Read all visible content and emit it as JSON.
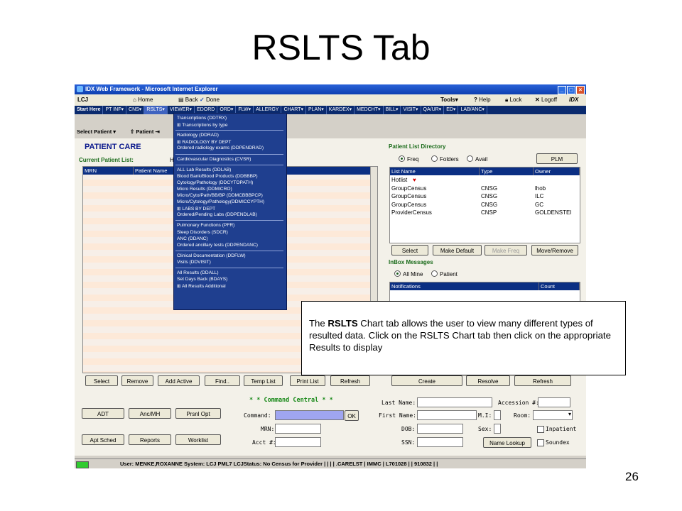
{
  "slide": {
    "title": "RSLTS Tab",
    "page_number": "26"
  },
  "window": {
    "title": "IDX Web Framework - Microsoft Internet Explorer",
    "user_code": "LCJ",
    "toolbar": {
      "home": "Home",
      "back": "Back",
      "done": "Done",
      "tools": "Tools",
      "help": "Help",
      "lock": "Lock",
      "logoff": "Logoff",
      "brand": "IDX"
    },
    "nav": [
      "Start Here",
      "PT INF▾",
      "CNS▾",
      "RSLTS▾",
      "VIEWER▾",
      "EDORD",
      "ORD▾",
      "FLW▾",
      "ALLERGY",
      "CHART▾",
      "PLAN▾",
      "KARDEX▾",
      "MEDCHT▾",
      "BILL▾",
      "VISIT▾",
      "QA/UR▾",
      "ED▾",
      "LAB/ANC▾"
    ],
    "subbar": {
      "select_patient": "Select Patient",
      "patient": "Patient"
    }
  },
  "dropdown": {
    "items": [
      "Transcriptions (DDTRX)",
      "⊞ Transcriptions by type",
      "-",
      "Radiology (DDRAD)",
      "⊞ RADIOLOGY BY DEPT",
      "Ordered radiology exams (DDPENDRAD)",
      "-",
      "Cardiovascular Diagnostics (CVSR)",
      "-",
      "ALL Lab Results (DDLAB)",
      "Blood Bank/Blood Products (DDBBBP)",
      "Cytology/Pathology (DDCYTOPATH)",
      "Micro Results (DDMICRO)",
      "Micro/Cyto/Path/BB/BP (DDMCBBBPCP)",
      "Micro/Cytology/Pathology(DDMICCYPTH)",
      "⊞ LABS BY DEPT",
      "Ordered/Pending Labs (DDPENDLAB)",
      "-",
      "Pulmonary Functions (PFR)",
      "Sleep Disorders (SDCR)",
      "ANC (DDANC)",
      "Ordered ancillary tests (DDPENDANC)",
      "-",
      "Clinical Documentation (DDFLW)",
      "Visits (DDVISIT)",
      "-",
      "All Results (DDALL)",
      "Set Days Back (BDAYS)",
      "⊞ All Results Additional"
    ]
  },
  "patient_care": {
    "heading": "PATIENT CARE",
    "current_list_label": "Current Patient List:",
    "current_list_value": "H",
    "columns": [
      "MRN",
      "Patient Name"
    ],
    "buttons": [
      "Select",
      "Remove",
      "Add Active",
      "Find..",
      "Temp List",
      "Print List",
      "Refresh",
      "Create",
      "Resolve",
      "Refresh"
    ]
  },
  "directory": {
    "heading": "Patient List Directory",
    "radios": [
      "Freq",
      "Folders",
      "Avail"
    ],
    "plm": "PLM",
    "columns": [
      "List Name",
      "Type",
      "Owner"
    ],
    "rows": [
      {
        "name": "Hotlist",
        "type": "",
        "owner": ""
      },
      {
        "name": "GroupCensus",
        "type": "CNSG",
        "owner": "lhob"
      },
      {
        "name": "GroupCensus",
        "type": "CNSG",
        "owner": "ILC"
      },
      {
        "name": "GroupCensus",
        "type": "CNSG",
        "owner": "GC"
      },
      {
        "name": "ProviderCensus",
        "type": "CNSP",
        "owner": "GOLDENSTEI"
      }
    ],
    "buttons": [
      "Select",
      "Make Default",
      "Make Freq",
      "Move/Remove"
    ]
  },
  "inbox": {
    "heading": "InBox Messages",
    "radios": [
      "All Mine",
      "Patient"
    ],
    "columns": [
      "Notifications",
      "Count"
    ]
  },
  "command": {
    "heading": "* * Command Central * *",
    "left_buttons": [
      "ADT",
      "Anc/MH",
      "Prsnl Opt",
      "Apt Sched",
      "Reports",
      "Worklist"
    ],
    "labels": {
      "command": "Command:",
      "mrn": "MRN:",
      "acct": "Acct #:",
      "ok": "OK"
    },
    "right_labels": {
      "last_name": "Last Name:",
      "accession": "Accession #:",
      "first_name": "First Name:",
      "mi": "M.I:",
      "room": "Room:",
      "dob": "DOB:",
      "sex": "Sex:",
      "inpatient": "Inpatient",
      "ssn": "SSN:",
      "name_lookup": "Name Lookup",
      "soundex": "Soundex"
    }
  },
  "statusbar": {
    "text": "User: MENKE,ROXANNE  System: LCJ PML7  LCJStatus: No Census for Provider | | | | .CARELST | IMMC | L701028 | | 910832 | |"
  },
  "callout": {
    "bold": "RSLTS",
    "pre": "The ",
    "post": " Chart tab allows the user to view many different types of resulted data.  Click on the RSLTS Chart tab then click on the appropriate Results to display"
  },
  "colors": {
    "nav_bg": "#0a2a6e",
    "title_blue": "#2a62d8",
    "menu_bg": "#1f3f8f",
    "grid_row": "#fde9d8"
  },
  "icons": [
    "home-icon",
    "back-icon",
    "checkmark-icon",
    "help-icon",
    "lock-icon",
    "close-x-icon",
    "heart-icon",
    "ie-icon"
  ]
}
